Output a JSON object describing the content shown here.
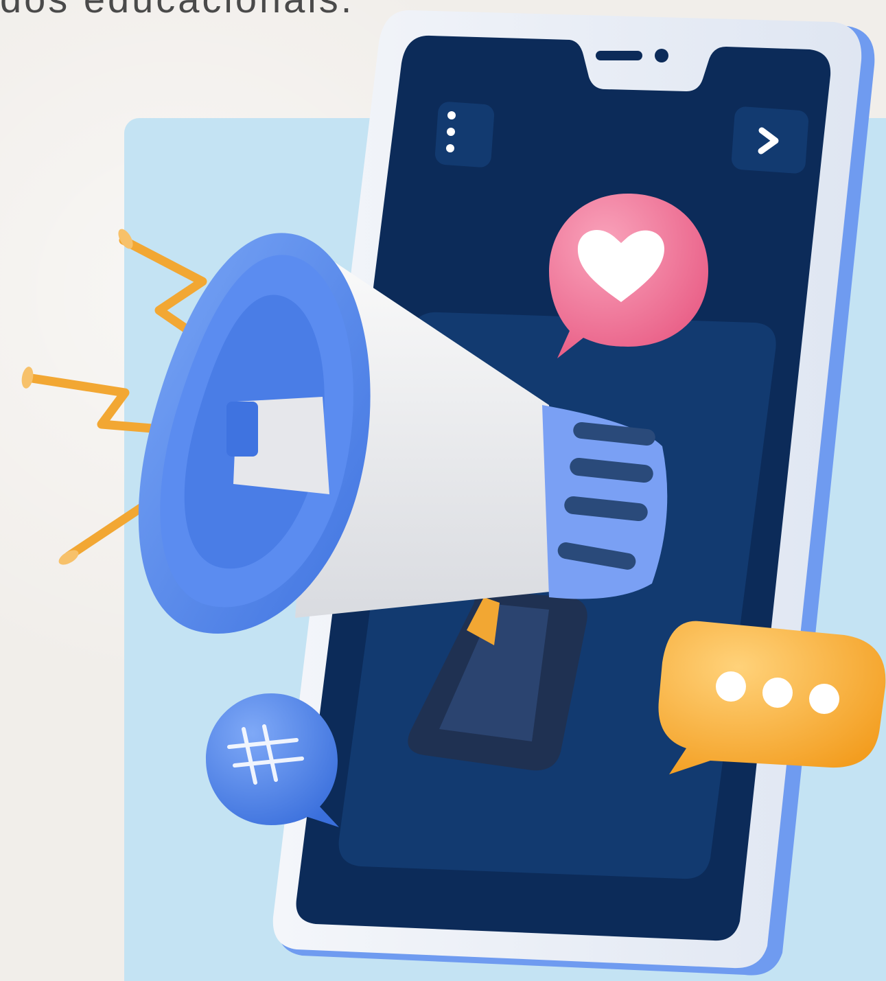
{
  "caption": {
    "text": "dos educacionais."
  },
  "colors": {
    "background": "#f1eeea",
    "panel": "#c4e3f3",
    "phone_frame": "#e9eef6",
    "phone_edge": "#6f9bf0",
    "screen": "#0c2b59",
    "screen_inner": "#123a70",
    "megaphone_blue": "#5b8cf0",
    "megaphone_white": "#eeeeee",
    "handle": "#1f3152",
    "heart_bubble": "#f06f93",
    "chat_bubble": "#f9b23d",
    "hashtag_bubble": "#4f86ee",
    "sound_waves": "#f2a733"
  },
  "icons": {
    "menu": "more-vertical-icon",
    "next": "chevron-right-icon",
    "heart": "heart-bubble-icon",
    "chat": "chat-typing-bubble-icon",
    "hashtag": "hashtag-bubble-icon",
    "megaphone": "megaphone-icon"
  }
}
